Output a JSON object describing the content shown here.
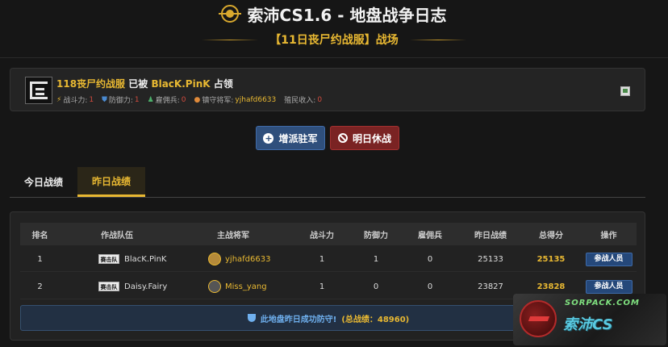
{
  "header": {
    "title": "索沛CS1.6 - 地盘战争日志",
    "subtitle": "【11日丧尸约战服】战场"
  },
  "owner": {
    "territory": "118丧尸约战服",
    "taken_by": "已被",
    "clan": "BlacK.PinK",
    "occupied": "占领",
    "stats": {
      "power_label": "战斗力:",
      "power": "1",
      "defense_label": "防御力:",
      "defense": "1",
      "merc_label": "雇佣兵:",
      "merc": "0",
      "general_label": "镇守将军:",
      "general": "yjhafd6633",
      "income_label": "殖民收入:",
      "income": "0"
    }
  },
  "actions": {
    "reinforce": "增派驻军",
    "rest": "明日休战"
  },
  "tabs": [
    {
      "label": "今日战绩",
      "active": false
    },
    {
      "label": "昨日战绩",
      "active": true
    }
  ],
  "table": {
    "headers": [
      "排名",
      "作战队伍",
      "主战将军",
      "战斗力",
      "防御力",
      "雇佣兵",
      "昨日战绩",
      "总得分",
      "操作"
    ],
    "rows": [
      {
        "rank": "1",
        "badge": "赛击队",
        "team": "BlacK.PinK",
        "general": "yjhafd6633",
        "power": "1",
        "defense": "1",
        "merc": "0",
        "yesterday": "25133",
        "total": "25135",
        "op": "参战人员"
      },
      {
        "rank": "2",
        "badge": "赛击队",
        "team": "Daisy.Fairy",
        "general": "Miss_yang",
        "power": "1",
        "defense": "0",
        "merc": "0",
        "yesterday": "23827",
        "total": "23828",
        "op": "参战人员"
      }
    ]
  },
  "defense_banner": {
    "text": "此地盘昨日成功防守!",
    "total": "(总战绩：48960)"
  },
  "watermark": {
    "url": "SORPACK.COM",
    "brand": "索沛CS"
  },
  "colors": {
    "accent": "#e8b832",
    "danger": "#d24b3e",
    "primary": "#2f4f7c",
    "info": "#6fb0ef"
  },
  "icons": [
    "crosshair-icon",
    "lightning-icon",
    "shield-icon",
    "soldier-icon",
    "user-icon",
    "plus-circle-icon",
    "ban-icon",
    "trophy-icon"
  ]
}
